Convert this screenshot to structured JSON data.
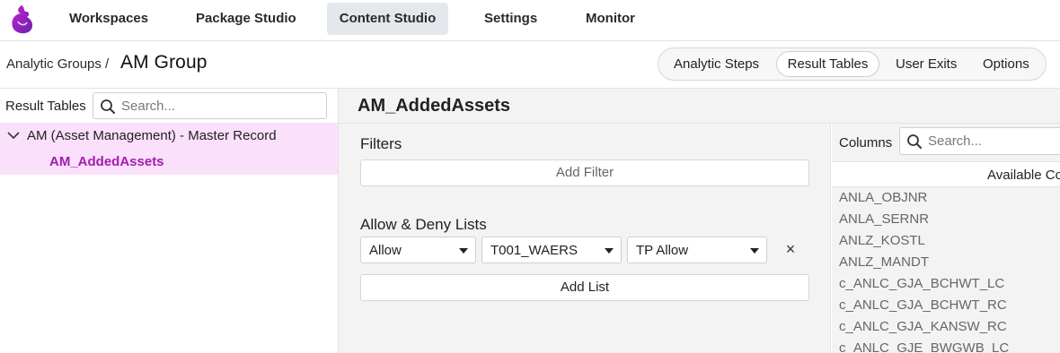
{
  "nav": {
    "tabs": [
      {
        "label": "Workspaces"
      },
      {
        "label": "Package Studio"
      },
      {
        "label": "Content Studio",
        "active": true
      },
      {
        "label": "Settings"
      },
      {
        "label": "Monitor"
      }
    ]
  },
  "header": {
    "breadcrumb": "Analytic Groups /",
    "title": "AM Group",
    "segments": [
      {
        "label": "Analytic Steps"
      },
      {
        "label": "Result Tables",
        "active": true
      },
      {
        "label": "User Exits"
      },
      {
        "label": "Options"
      }
    ]
  },
  "left_pane": {
    "label": "Result Tables",
    "search_placeholder": "Search...",
    "tree": {
      "parent": "AM (Asset Management) - Master Record",
      "child": "AM_AddedAssets"
    }
  },
  "main": {
    "title": "AM_AddedAssets",
    "filters_heading": "Filters",
    "add_filter_label": "Add Filter",
    "lists_heading": "Allow & Deny Lists",
    "list_row": {
      "type": "Allow",
      "field": "T001_WAERS",
      "value": "TP Allow",
      "remove_label": "×"
    },
    "add_list_label": "Add List"
  },
  "columns_pane": {
    "label": "Columns",
    "search_placeholder": "Search...",
    "header": "Available Co",
    "items": [
      "ANLA_OBJNR",
      "ANLA_SERNR",
      "ANLZ_KOSTL",
      "ANLZ_MANDT",
      "c_ANLC_GJA_BCHWT_LC",
      "c_ANLC_GJA_BCHWT_RC",
      "c_ANLC_GJA_KANSW_RC",
      "c_ANLC_GJE_BWGWB_LC"
    ]
  },
  "colors": {
    "accent": "#a21caf",
    "selected_bg": "#fbe0fb",
    "active_tab_bg": "#e4e8ed",
    "panel_bg": "#f3f3f3"
  }
}
